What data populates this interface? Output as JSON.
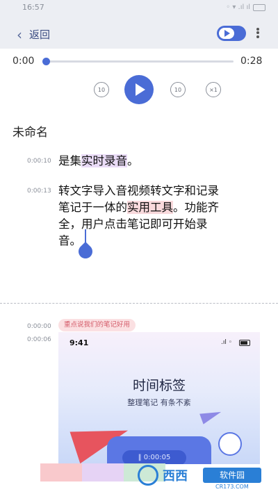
{
  "status_bar": {
    "time": "16:57",
    "signal": "◦ ▾ .ıl ıl"
  },
  "header": {
    "back_label": "返回"
  },
  "player": {
    "current_time": "0:00",
    "total_time": "0:28",
    "progress": 0.0,
    "rewind_label": "10",
    "forward_label": "10",
    "speed_label": "×1"
  },
  "transcript": {
    "title": "未命名",
    "segments": [
      {
        "timestamp": "0:00:10",
        "parts": [
          "是集",
          "实时录音",
          "。"
        ]
      },
      {
        "timestamp": "0:00:13",
        "line1": "转文字导入音视频转文字和记录",
        "line2_pre": "笔记于一体的",
        "line2_hl": "实用工具",
        "line2_post": "。功能齐",
        "line3": "全，用户点击笔记即可开始录",
        "line4": "音。"
      }
    ]
  },
  "notes": {
    "items": [
      {
        "timestamp": "0:00:00",
        "tag": "重点说我们的笔记好用"
      },
      {
        "timestamp": "0:00:06"
      }
    ],
    "image": {
      "phone_time": "9:41",
      "heading": "时间标签",
      "subheading": "整理笔记 有条不紊",
      "timer": "‖  0:00:05"
    }
  },
  "colors": {
    "accent": "#4a6cd6",
    "highlight_purple": "#eadcf7",
    "highlight_pink": "#f8d9dc",
    "bar1": "#f9c9cc",
    "bar2": "#e6d3f5",
    "bar3": "#cde9d6"
  },
  "watermark": {
    "brand": "西西",
    "label": "软件园",
    "url": "CR173.COM"
  }
}
